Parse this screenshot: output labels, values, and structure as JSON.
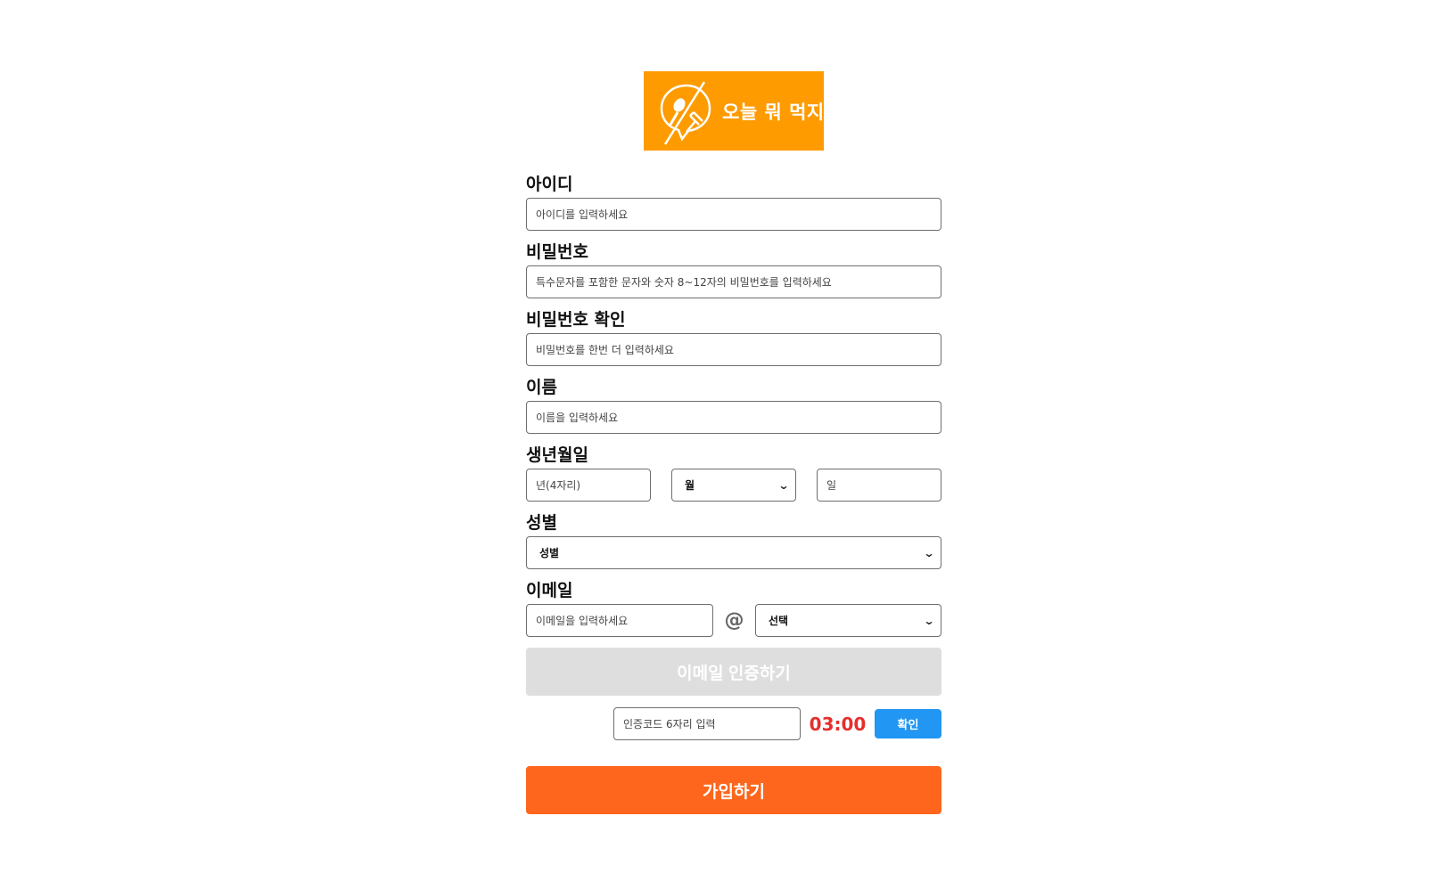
{
  "logo": {
    "text": "오늘 뭐 먹지?",
    "brand_color": "#fe9b00"
  },
  "fields": {
    "id": {
      "label": "아이디",
      "placeholder": "아이디를 입력하세요"
    },
    "password": {
      "label": "비밀번호",
      "placeholder": "특수문자를 포함한 문자와 숫자 8~12자의 비밀번호를 입력하세요"
    },
    "password_confirm": {
      "label": "비밀번호 확인",
      "placeholder": "비밀번호를 한번 더 입력하세요"
    },
    "name": {
      "label": "이름",
      "placeholder": "이름을 입력하세요"
    },
    "birth": {
      "label": "생년월일",
      "year_placeholder": "년(4자리)",
      "month_selected": "월",
      "day_placeholder": "일"
    },
    "gender": {
      "label": "성별",
      "selected": "성별"
    },
    "email": {
      "label": "이메일",
      "placeholder": "이메일을 입력하세요",
      "at": "@",
      "domain_selected": "선택"
    }
  },
  "verify": {
    "email_button": "이메일 인증하기",
    "code_placeholder": "인증코드 6자리 입력",
    "timer": "03:00",
    "confirm_button": "확인"
  },
  "signup_button": "가입하기",
  "colors": {
    "signup": "#fd661c",
    "confirm": "#2196f3",
    "timer": "#e62e2e",
    "disabled": "#dedede"
  }
}
